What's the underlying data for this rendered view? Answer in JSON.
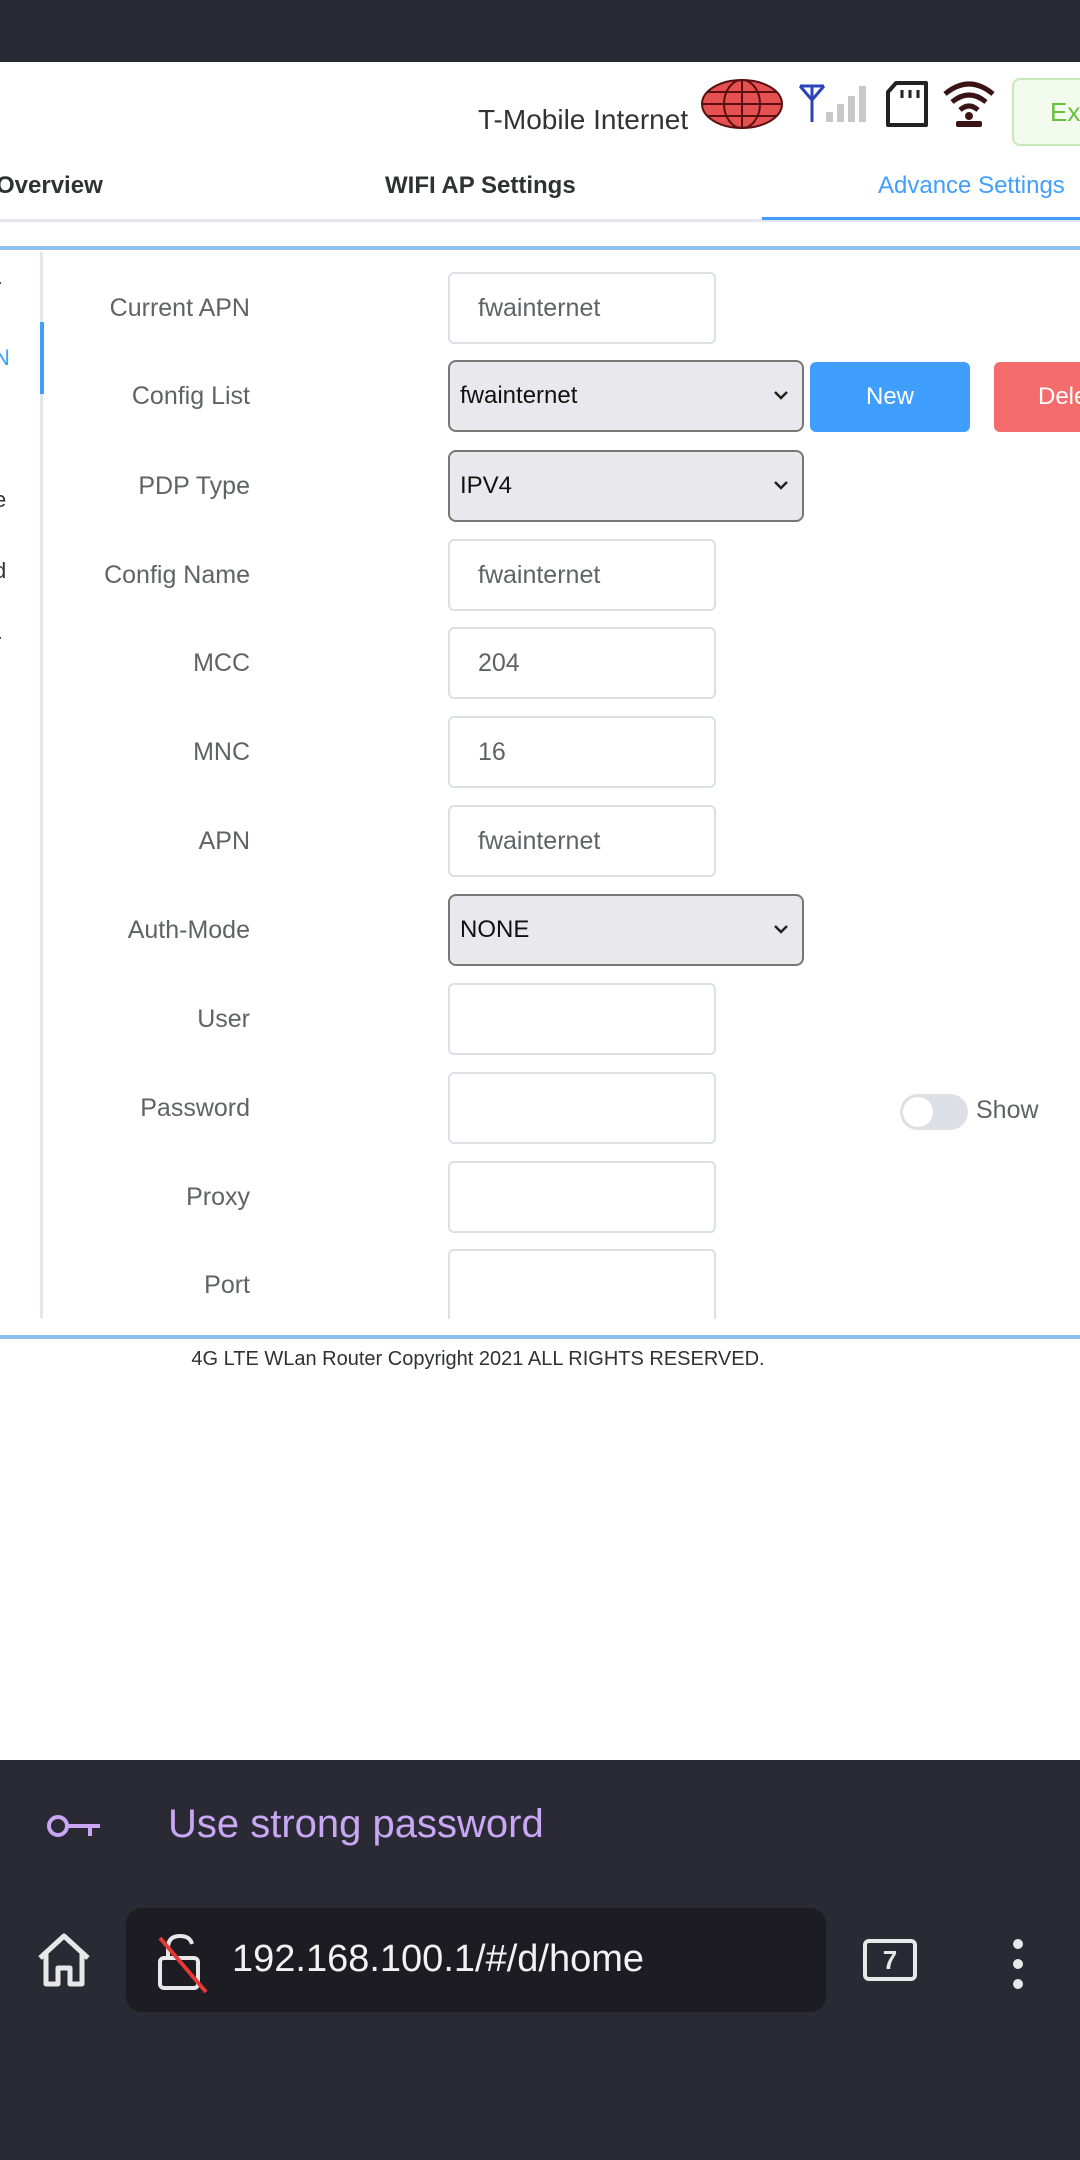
{
  "header": {
    "carrier": "T-Mobile Internet",
    "exit_label": "Exit"
  },
  "tabs": [
    {
      "label": "Overview"
    },
    {
      "label": "WIFI AP Settings"
    },
    {
      "label": "Advance Settings"
    }
  ],
  "sidebar": {
    "items": [
      {
        "label": "r"
      },
      {
        "label": "N"
      },
      {
        "label": "t"
      },
      {
        "label": "e"
      },
      {
        "label": "d"
      },
      {
        "label": "r"
      }
    ]
  },
  "form": {
    "current_apn": {
      "label": "Current APN",
      "value": "fwainternet"
    },
    "config_list": {
      "label": "Config List",
      "value": "fwainternet"
    },
    "pdp_type": {
      "label": "PDP Type",
      "value": "IPV4"
    },
    "config_name": {
      "label": "Config Name",
      "value": "fwainternet"
    },
    "mcc": {
      "label": "MCC",
      "value": "204"
    },
    "mnc": {
      "label": "MNC",
      "value": "16"
    },
    "apn": {
      "label": "APN",
      "value": "fwainternet"
    },
    "auth_mode": {
      "label": "Auth-Mode",
      "value": "NONE"
    },
    "user": {
      "label": "User",
      "value": ""
    },
    "password": {
      "label": "Password",
      "value": ""
    },
    "proxy": {
      "label": "Proxy",
      "value": ""
    },
    "port": {
      "label": "Port",
      "value": ""
    },
    "new_label": "New",
    "delete_label": "Delete",
    "show_label": "Show"
  },
  "footer": {
    "copyright": "4G LTE WLan Router Copyright 2021 ALL RIGHTS RESERVED."
  },
  "browser": {
    "password_suggestion": "Use strong password",
    "url": "192.168.100.1/#/d/home",
    "tab_count": "7"
  },
  "colors": {
    "accent": "#409eff",
    "danger": "#f56c6c",
    "success": "#67c23a",
    "browser_bg": "#2a2a35"
  }
}
